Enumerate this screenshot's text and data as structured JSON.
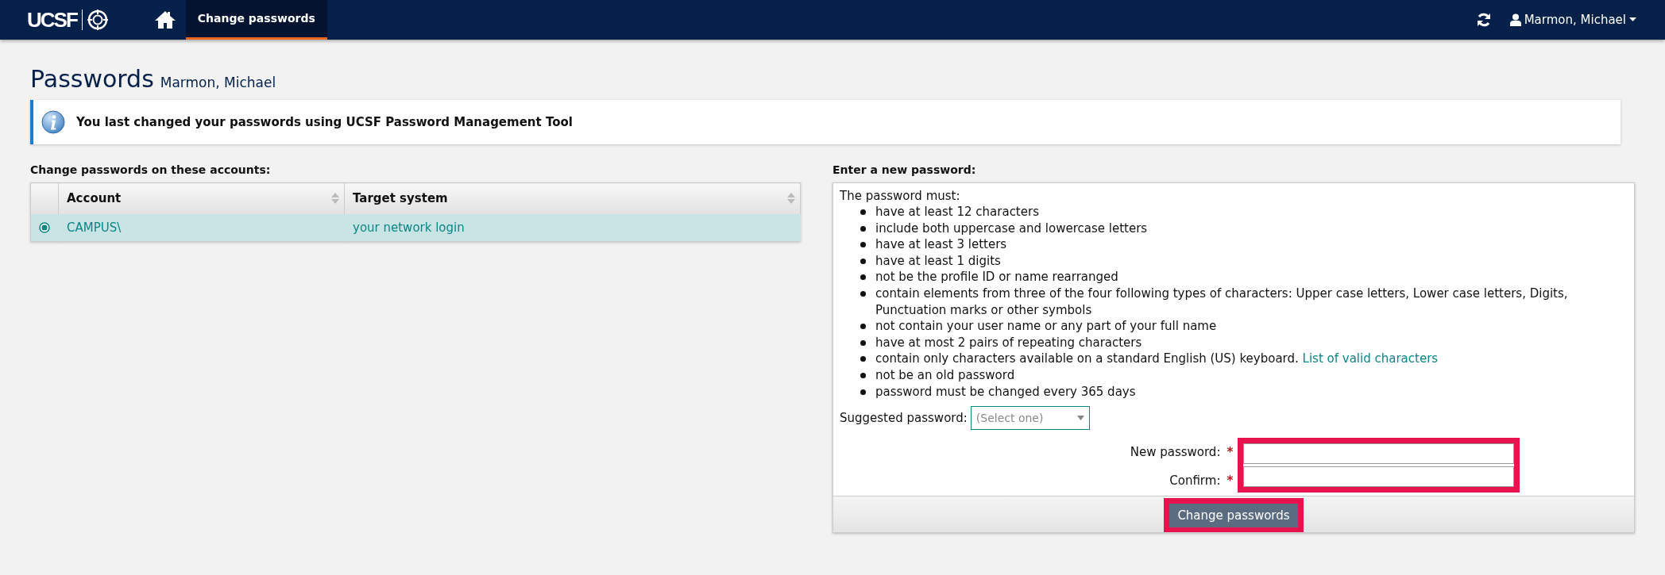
{
  "navbar": {
    "logo": "UCSF",
    "tabs": [
      {
        "label": "Change passwords",
        "selected": true
      }
    ],
    "user": "Marmon, Michael"
  },
  "page": {
    "title": "Passwords",
    "subtitle": "Marmon, Michael"
  },
  "info": {
    "message": "You last changed your passwords using UCSF Password Management Tool"
  },
  "accounts": {
    "heading": "Change passwords on these accounts:",
    "columns": [
      "Account",
      "Target system"
    ],
    "rows": [
      {
        "account": "CAMPUS\\",
        "target": "your network login",
        "selected": true
      }
    ]
  },
  "password_panel": {
    "heading": "Enter a new password:",
    "intro": "The password must:",
    "rules": [
      {
        "text": "have at least 12 characters"
      },
      {
        "text": "include both uppercase and lowercase letters"
      },
      {
        "text": "have at least 3 letters"
      },
      {
        "text": "have at least 1 digits"
      },
      {
        "text": "not be the profile ID or name rearranged"
      },
      {
        "text": "contain elements from three of the four following types of characters: Upper case letters, Lower case letters, Digits, Punctuation marks or other symbols"
      },
      {
        "text": "not contain your user name or any part of your full name"
      },
      {
        "text": "have at most 2 pairs of repeating characters"
      },
      {
        "text": "contain only characters available on a standard English (US) keyboard.",
        "link": "List of valid characters"
      },
      {
        "text": "not be an old password"
      },
      {
        "text": "password must be changed every 365 days"
      }
    ],
    "suggested": {
      "label": "Suggested password:",
      "placeholder": "(Select one)"
    },
    "fields": [
      {
        "label": "New password:",
        "required_mark": "*"
      },
      {
        "label": "Confirm:",
        "required_mark": "*"
      }
    ],
    "submit": "Change passwords",
    "highlighted": true
  }
}
